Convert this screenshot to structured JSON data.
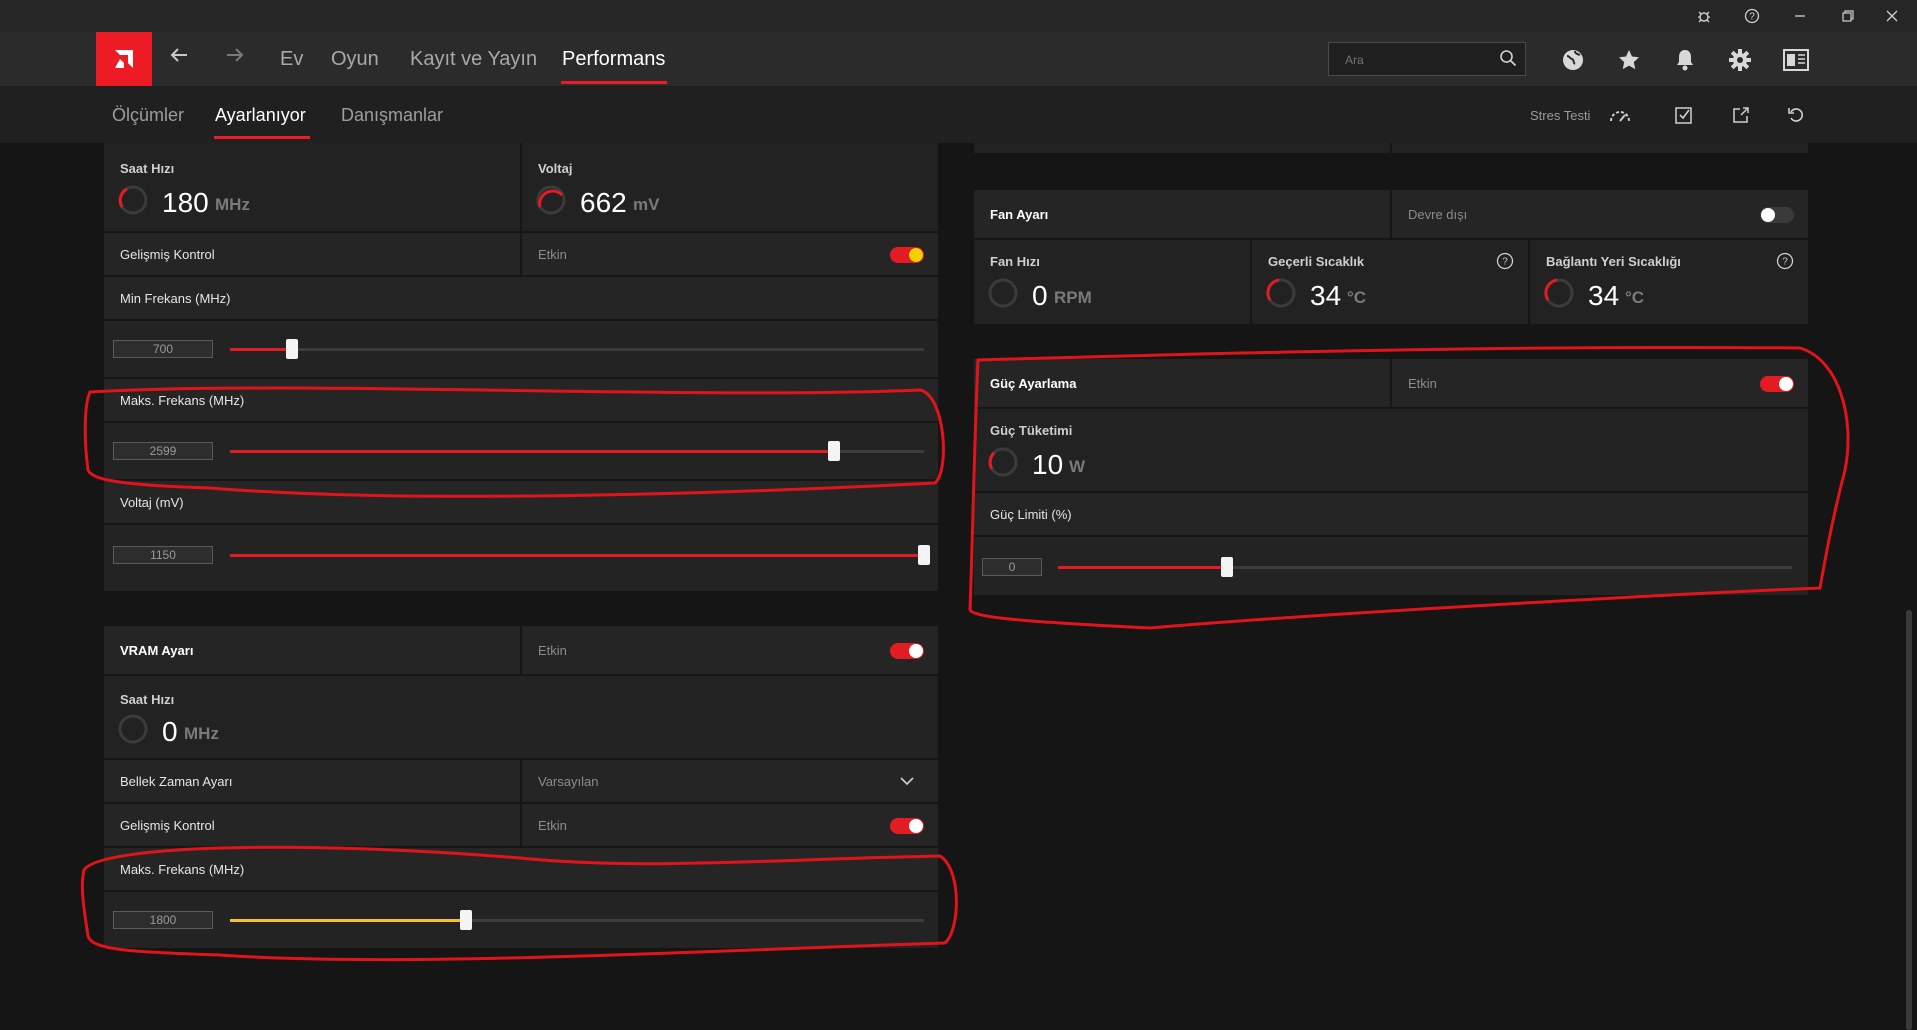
{
  "titlebar": {
    "icons": [
      "bug-icon",
      "help-icon",
      "minimize-icon",
      "restore-icon",
      "close-icon"
    ]
  },
  "nav": {
    "tabs": [
      "Ev",
      "Oyun",
      "Kayıt ve Yayın",
      "Performans"
    ],
    "active_tab": "Performans",
    "search_placeholder": "Ara",
    "icons": [
      "globe-icon",
      "star-icon",
      "bell-icon",
      "gear-icon",
      "layout-icon"
    ]
  },
  "subnav": {
    "tabs": [
      "Ölçümler",
      "Ayarlanıyor",
      "Danışmanlar"
    ],
    "active_tab": "Ayarlanıyor",
    "stress_test_label": "Stres Testi",
    "icons": [
      "gauge-icon",
      "checklist-icon",
      "export-icon",
      "reset-icon"
    ]
  },
  "gpu_panel": {
    "clock": {
      "title": "Saat Hızı",
      "value": "180",
      "unit": "MHz"
    },
    "voltage": {
      "title": "Voltaj",
      "value": "662",
      "unit": "mV"
    },
    "advanced_control": {
      "label": "Gelişmiş Kontrol",
      "state_label": "Etkin",
      "enabled": true
    },
    "min_freq": {
      "label": "Min Frekans (MHz)",
      "value": "700",
      "fraction": 0.09
    },
    "max_freq": {
      "label": "Maks. Frekans (MHz)",
      "value": "2599",
      "fraction": 0.87
    },
    "voltage_mv": {
      "label": "Voltaj (mV)",
      "value": "1150",
      "fraction": 1.0
    }
  },
  "vram_panel": {
    "title": "VRAM Ayarı",
    "state_label": "Etkin",
    "enabled": true,
    "clock": {
      "title": "Saat Hızı",
      "value": "0",
      "unit": "MHz"
    },
    "memory_timing": {
      "label": "Bellek Zaman Ayarı",
      "value": "Varsayılan"
    },
    "advanced_control": {
      "label": "Gelişmiş Kontrol",
      "state_label": "Etkin",
      "enabled": true
    },
    "max_freq": {
      "label": "Maks. Frekans (MHz)",
      "value": "1800",
      "fraction": 0.34
    }
  },
  "fan_panel": {
    "title": "Fan Ayarı",
    "state_label": "Devre dışı",
    "enabled": false,
    "fan_speed": {
      "title": "Fan Hızı",
      "value": "0",
      "unit": "RPM"
    },
    "current_temp": {
      "title": "Geçerli Sıcaklık",
      "value": "34",
      "unit": "°C"
    },
    "junction_temp": {
      "title": "Bağlantı Yeri Sıcaklığı",
      "value": "34",
      "unit": "°C"
    }
  },
  "power_panel": {
    "title": "Güç Ayarlama",
    "state_label": "Etkin",
    "enabled": true,
    "consumption": {
      "title": "Güç Tüketimi",
      "value": "10",
      "unit": "W"
    },
    "limit": {
      "label": "Güç Limiti (%)",
      "value": "0",
      "fraction": 0.23
    }
  },
  "colors": {
    "accent": "#e31b23",
    "vram_slider": "#f2c230",
    "annotation": "#e0141b"
  }
}
